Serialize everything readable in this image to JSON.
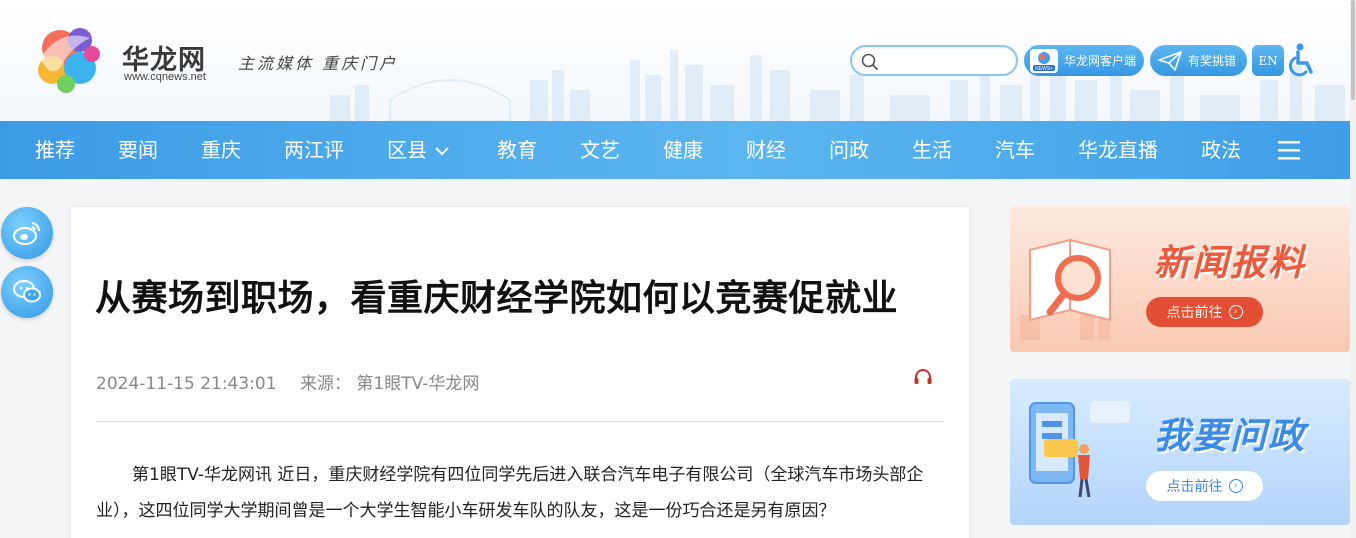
{
  "header": {
    "logo_name": "华龙网",
    "logo_url": "www.cqnews.net",
    "slogan": "主流媒体  重庆门户",
    "search_placeholder": "",
    "app_button_label": "华龙网客户端",
    "app_icon_badge": "NEWS+",
    "prize_button_label": "有奖挑错",
    "lang_button_label": "EN"
  },
  "nav": {
    "items": [
      "推荐",
      "要闻",
      "重庆",
      "两江评",
      "区县",
      "教育",
      "文艺",
      "健康",
      "财经",
      "问政",
      "生活",
      "汽车",
      "华龙直播",
      "政法"
    ]
  },
  "article": {
    "title": "从赛场到职场，看重庆财经学院如何以竞赛促就业",
    "date": "2024-11-15 21:43:01",
    "source": "来源： 第1眼TV-华龙网",
    "body": "第1眼TV-华龙网讯 近日，重庆财经学院有四位同学先后进入联合汽车电子有限公司（全球汽车市场头部企业），这四位同学大学期间曾是一个大学生智能小车研发车队的队友，这是一份巧合还是另有原因？"
  },
  "sidebar": {
    "report": {
      "title": "新闻报料",
      "button": "点击前往"
    },
    "gov": {
      "title": "我要问政",
      "button": "点击前往"
    }
  },
  "colors": {
    "nav_blue": "#4aa8eb",
    "report_red": "#e24f35",
    "gov_blue": "#3b8ae6"
  }
}
